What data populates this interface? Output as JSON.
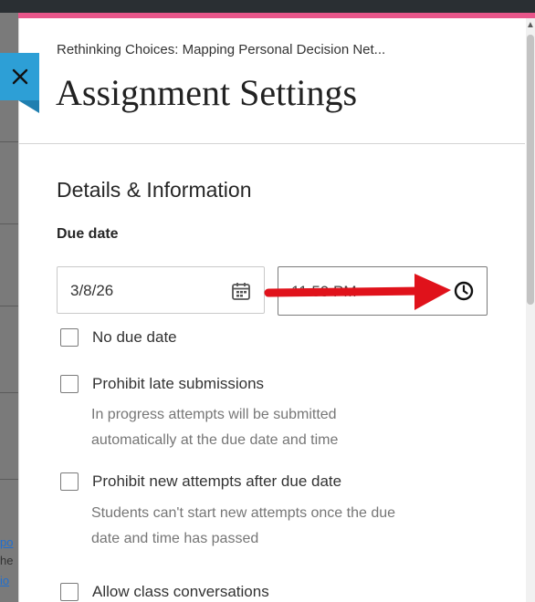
{
  "breadcrumb": "Rethinking Choices: Mapping Personal Decision Net...",
  "title": "Assignment Settings",
  "close_icon": "close-icon",
  "section_heading": "Details & Information",
  "due_date": {
    "label": "Due date",
    "date_value": "3/8/26",
    "date_icon": "calendar-icon",
    "time_value": "11:59 PM",
    "time_icon": "clock-icon"
  },
  "options": [
    {
      "label": "No due date",
      "checked": false
    },
    {
      "label": "Prohibit late submissions",
      "checked": false,
      "help": [
        "In progress attempts will be submitted",
        "automatically at the due date and time"
      ]
    },
    {
      "label": "Prohibit new attempts after due date",
      "checked": false,
      "help": [
        "Students can't start new attempts once the due",
        "date and time has passed"
      ]
    },
    {
      "label": "Allow class conversations",
      "checked": false
    }
  ],
  "colors": {
    "accent_pink": "#e8568a",
    "close_tab": "#2d9fd6",
    "annotation_red": "#e0121b"
  }
}
